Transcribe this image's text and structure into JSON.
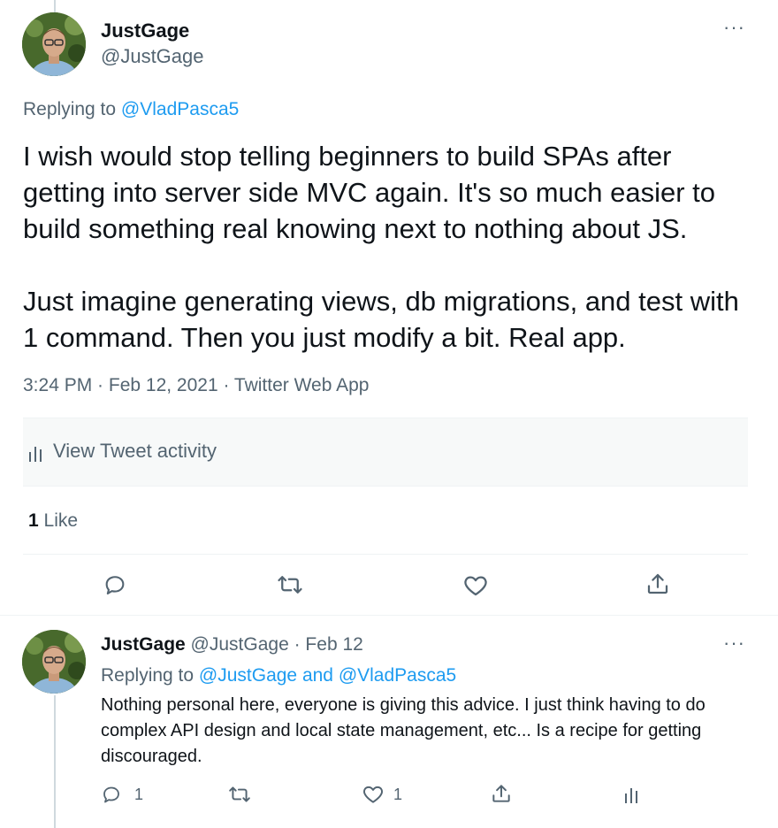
{
  "main_tweet": {
    "author_name": "JustGage",
    "author_handle": "@JustGage",
    "replying_prefix": "Replying to",
    "replying_to": "@VladPasca5",
    "text_p1": "I wish would stop telling beginners to build SPAs after getting into server side MVC again. It's so much easier to build something real knowing next to nothing about JS.",
    "text_p2": "Just imagine generating views, db migrations, and test with 1 command. Then you just modify a bit. Real app.",
    "timestamp": "3:24 PM · Feb 12, 2021 · Twitter Web App",
    "activity_label": "View Tweet activity",
    "likes_count": "1",
    "likes_label": "Like",
    "more": "···"
  },
  "reply_tweet": {
    "author_name": "JustGage",
    "author_handle": "@JustGage",
    "date": "· Feb 12",
    "replying_prefix": "Replying to",
    "replying_to": "@JustGage and @VladPasca5",
    "text": "Nothing personal here, everyone is giving this advice. I just think having to do complex API design and local state management, etc... Is a recipe for getting discouraged.",
    "reply_count": "1",
    "like_count": "1",
    "more": "···"
  },
  "colors": {
    "accent": "#1d9bf0",
    "muted": "#536471",
    "text": "#0f1419"
  }
}
